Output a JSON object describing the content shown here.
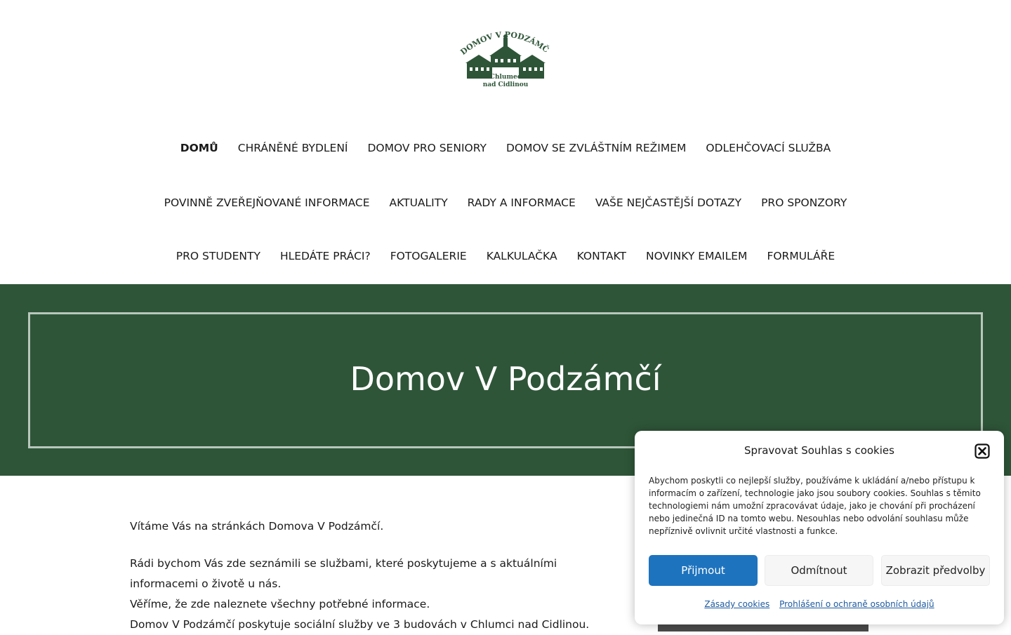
{
  "logo": {
    "text_top": "DOMOV V PODZÁMČÍ",
    "text_line1": "Chlumec",
    "text_line2": "nad Cidlinou",
    "color": "#2e5538"
  },
  "nav": {
    "row1": [
      "DOMŮ",
      "CHRÁNĚNÉ BYDLENÍ",
      "DOMOV PRO SENIORY",
      "DOMOV SE ZVLÁŠTNÍM REŽIMEM",
      "ODLEHČOVACÍ SLUŽBA"
    ],
    "row2": [
      "POVINNĚ ZVEŘEJŇOVANÉ INFORMACE",
      "AKTUALITY",
      "RADY A INFORMACE",
      "VAŠE NEJČASTĚJŠÍ DOTAZY",
      "PRO SPONZORY"
    ],
    "row3": [
      "PRO STUDENTY",
      "HLEDÁTE PRÁCI?",
      "FOTOGALERIE",
      "KALKULAČKA",
      "KONTAKT",
      "NOVINKY EMAILEM",
      "FORMULÁŘE"
    ],
    "active": "DOMŮ"
  },
  "hero": {
    "title": "Domov V Podzámčí",
    "bg_color": "#2e5538"
  },
  "content": {
    "p1": "Vítáme Vás na stránkách Domova V Podzámčí.",
    "p2": "Rádi bychom Vás zde seznámili se službami, které poskytujeme a s aktuálními informacemi o životě u nás.",
    "p3": "Věříme, že zde naleznete všechny potřebné informace.",
    "p4": "Domov V Podzámčí poskytuje sociální služby ve 3 budovách v Chlumci nad Cidlinou."
  },
  "cookie": {
    "title": "Spravovat Souhlas s cookies",
    "text": "Abychom poskytli co nejlepší služby, používáme k ukládání a/nebo přístupu k informacím o zařízení, technologie jako jsou soubory cookies. Souhlas s těmito technologiemi nám umožní zpracovávat údaje, jako je chování při procházení nebo jedinečná ID na tomto webu. Nesouhlas nebo odvolání souhlasu může nepříznivě ovlivnit určité vlastnosti a funkce.",
    "accept": "Přijmout",
    "deny": "Odmítnout",
    "prefs": "Zobrazit předvolby",
    "link1": "Zásady cookies",
    "link2": "Prohlášení o ochraně osobních údajů",
    "accent_color": "#1e73be"
  }
}
